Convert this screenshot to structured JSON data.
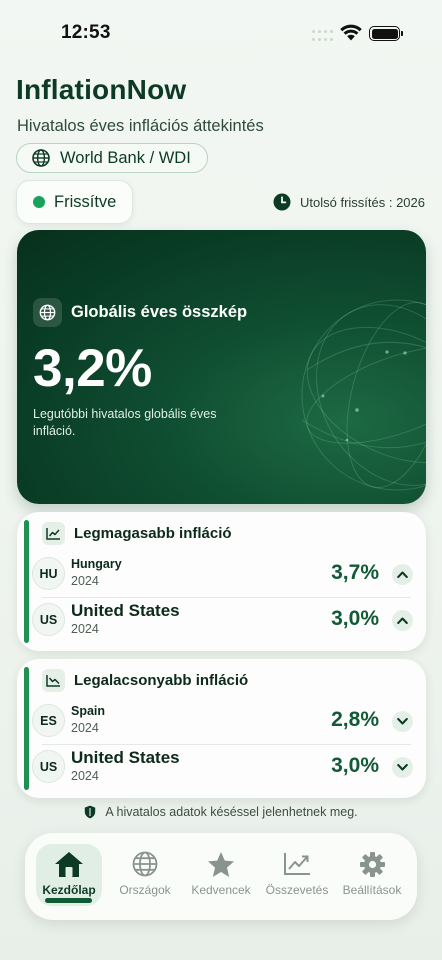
{
  "status_bar": {
    "time": "12:53"
  },
  "header": {
    "title": "InflationNow",
    "subtitle": "Hivatalos éves inflációs áttekintés",
    "source": "World Bank / WDI",
    "status": "Frissítve",
    "last_update": "Utolsó frissítés : 2026"
  },
  "hero": {
    "title": "Globális éves összkép",
    "value": "3,2%",
    "description": "Legutóbbi hivatalos globális éves infláció."
  },
  "highest": {
    "title": "Legmagasabb infláció",
    "rows": [
      {
        "code": "HU",
        "country": "Hungary",
        "year": "2024",
        "rate": "3,7%",
        "trend": "up"
      },
      {
        "code": "US",
        "country": "United States",
        "year": "2024",
        "rate": "3,0%",
        "trend": "up"
      }
    ]
  },
  "lowest": {
    "title": "Legalacsonyabb infláció",
    "rows": [
      {
        "code": "ES",
        "country": "Spain",
        "year": "2024",
        "rate": "2,8%",
        "trend": "down"
      },
      {
        "code": "US",
        "country": "United States",
        "year": "2024",
        "rate": "3,0%",
        "trend": "down"
      }
    ]
  },
  "disclaimer": "A hivatalos adatok késéssel jelenhetnek meg.",
  "tabs": [
    {
      "label": "Kezdőlap",
      "icon": "home-icon",
      "active": true
    },
    {
      "label": "Országok",
      "icon": "globe-icon",
      "active": false
    },
    {
      "label": "Kedvencek",
      "icon": "star-icon",
      "active": false
    },
    {
      "label": "Összevetés",
      "icon": "chart-line-icon",
      "active": false
    },
    {
      "label": "Beállítások",
      "icon": "gear-icon",
      "active": false
    }
  ],
  "colors": {
    "accent": "#0d3a24",
    "positive": "#17a35b",
    "hero_bg": "#093b24"
  }
}
